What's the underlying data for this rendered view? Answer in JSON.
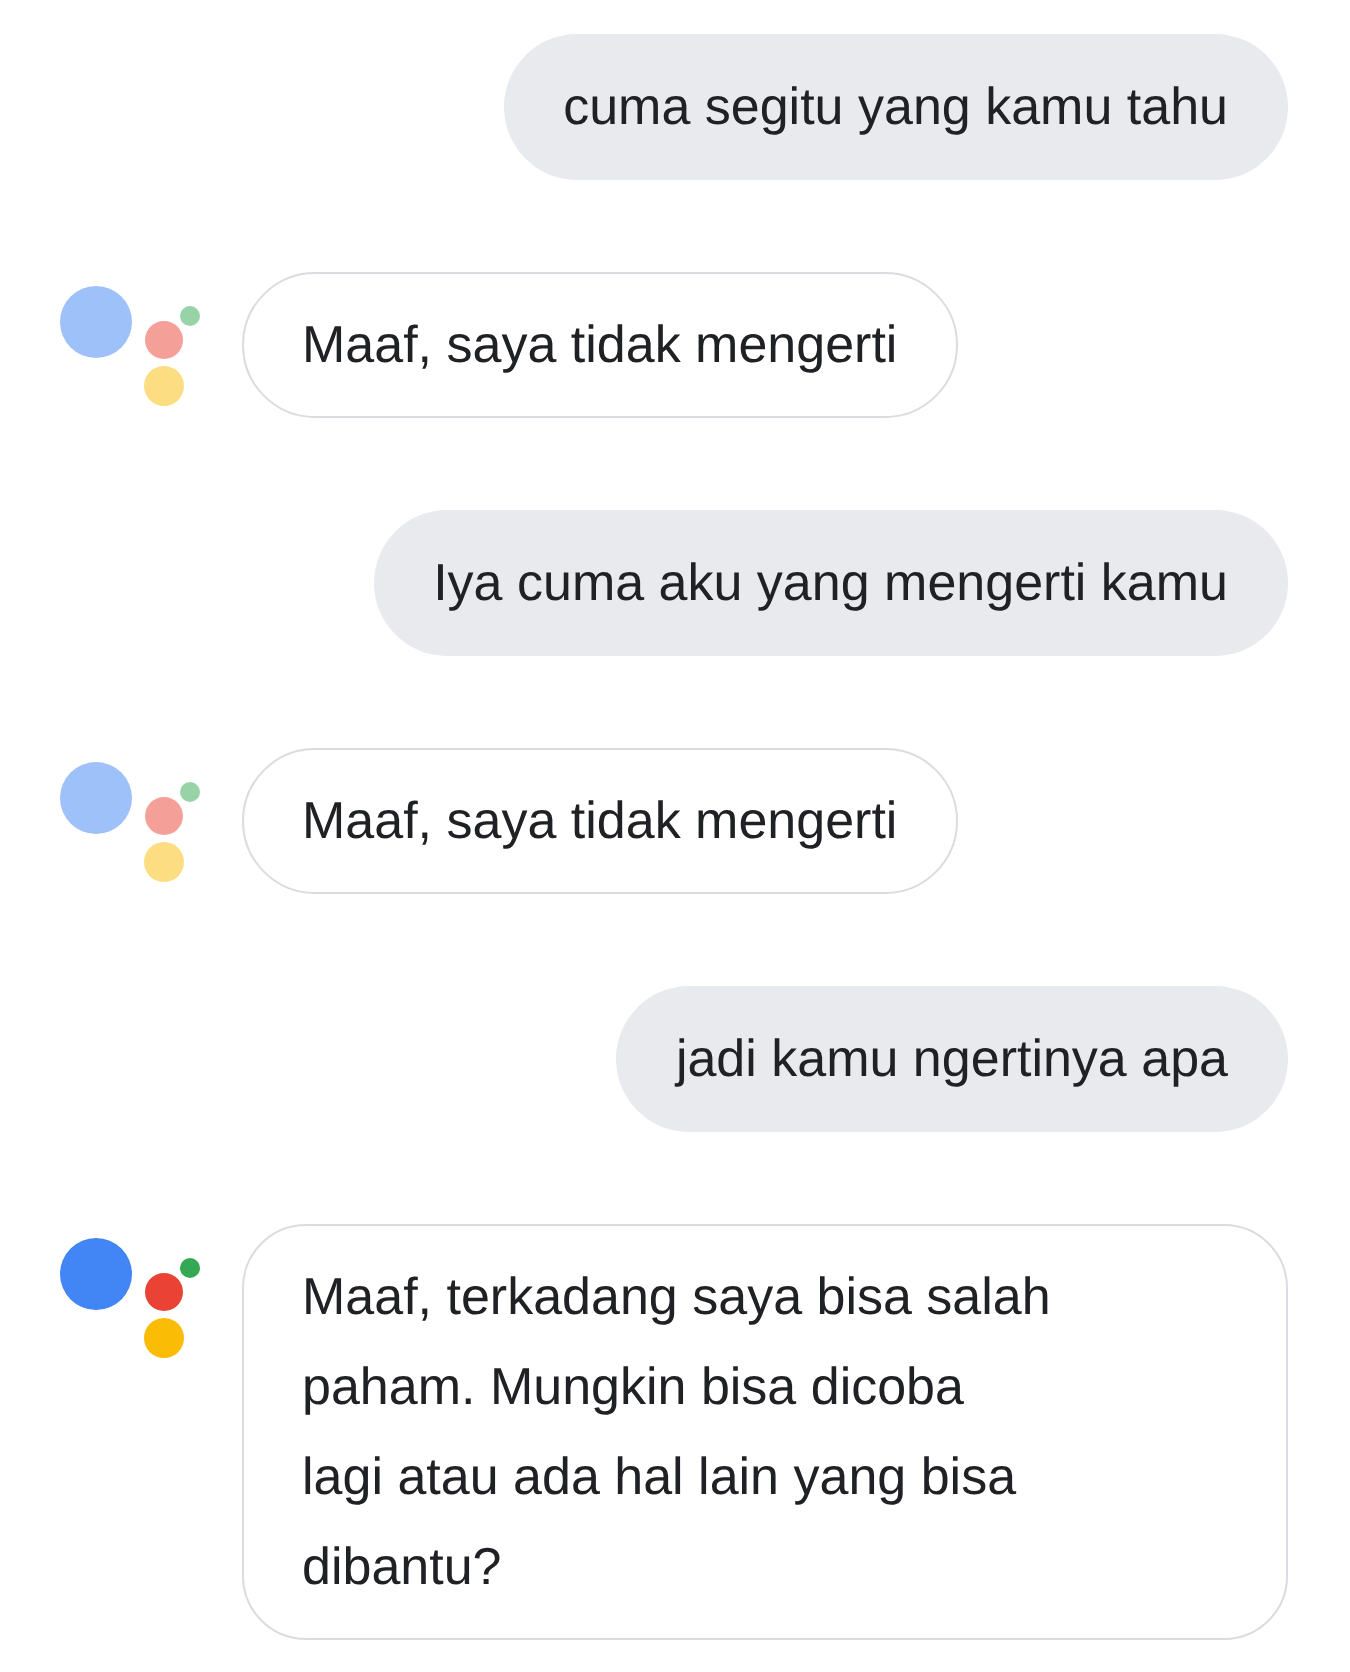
{
  "messages": [
    {
      "kind": "user",
      "text": "cuma segitu yang kamu tahu"
    },
    {
      "kind": "assistant",
      "dimmed": true,
      "text": "Maaf, saya tidak mengerti"
    },
    {
      "kind": "user",
      "text": "Iya cuma aku yang mengerti kamu"
    },
    {
      "kind": "assistant",
      "dimmed": true,
      "text": "Maaf, saya tidak mengerti"
    },
    {
      "kind": "user",
      "text": "jadi kamu ngertinya apa"
    },
    {
      "kind": "assistant",
      "dimmed": false,
      "text": "Maaf, terkadang saya bisa salah\npaham. Mungkin bisa dicoba\nlagi atau ada hal lain yang bisa\ndibantu?"
    }
  ]
}
